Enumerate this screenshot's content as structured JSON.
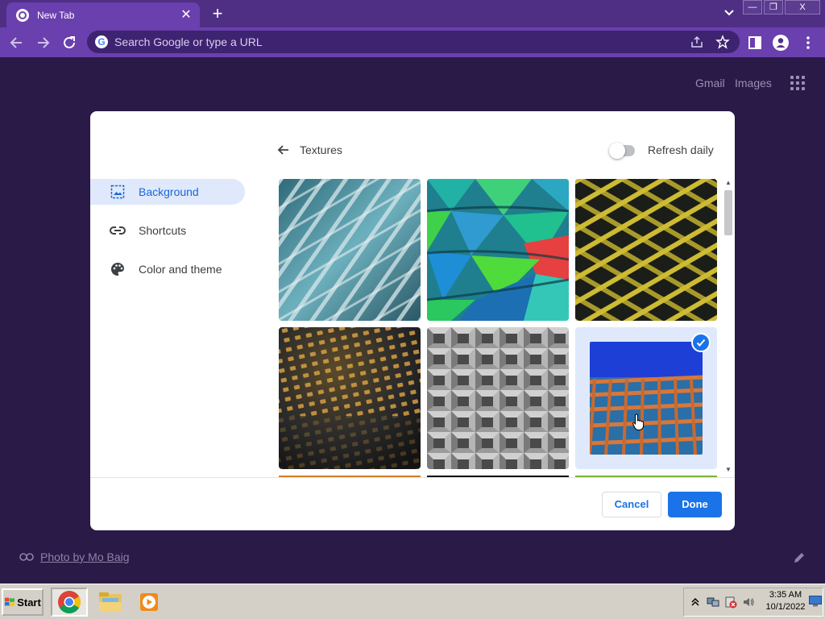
{
  "browser": {
    "tab_title": "New Tab",
    "tab_close_glyph": "✕",
    "new_tab_glyph": "+",
    "omnibox_placeholder": "Search Google or type a URL",
    "window_buttons": {
      "minimize": "—",
      "restore": "❐",
      "close": "X"
    },
    "accent_color": "#6a3fae"
  },
  "ntp": {
    "gmail_link": "Gmail",
    "images_link": "Images",
    "attribution_text": "Photo by Mo Baig"
  },
  "customize_dialog": {
    "nav": [
      {
        "label": "Background",
        "icon": "image-icon",
        "active": true
      },
      {
        "label": "Shortcuts",
        "icon": "link-icon",
        "active": false
      },
      {
        "label": "Color and theme",
        "icon": "palette-icon",
        "active": false
      }
    ],
    "panel_title": "Textures",
    "refresh_daily_label": "Refresh daily",
    "refresh_daily_on": false,
    "tiles": [
      {
        "name": "teal-glass-facade",
        "selected": false
      },
      {
        "name": "colorful-panels",
        "selected": false
      },
      {
        "name": "yellow-lattice",
        "selected": false
      },
      {
        "name": "lit-grid-dome",
        "selected": false
      },
      {
        "name": "gray-concrete-cells",
        "selected": false
      },
      {
        "name": "orange-grid-blue-sky",
        "selected": true
      }
    ],
    "cancel_label": "Cancel",
    "done_label": "Done",
    "primary_color": "#1a73e8"
  },
  "taskbar": {
    "start_label": "Start",
    "clock_time": "3:35 AM",
    "clock_date": "10/1/2022"
  }
}
